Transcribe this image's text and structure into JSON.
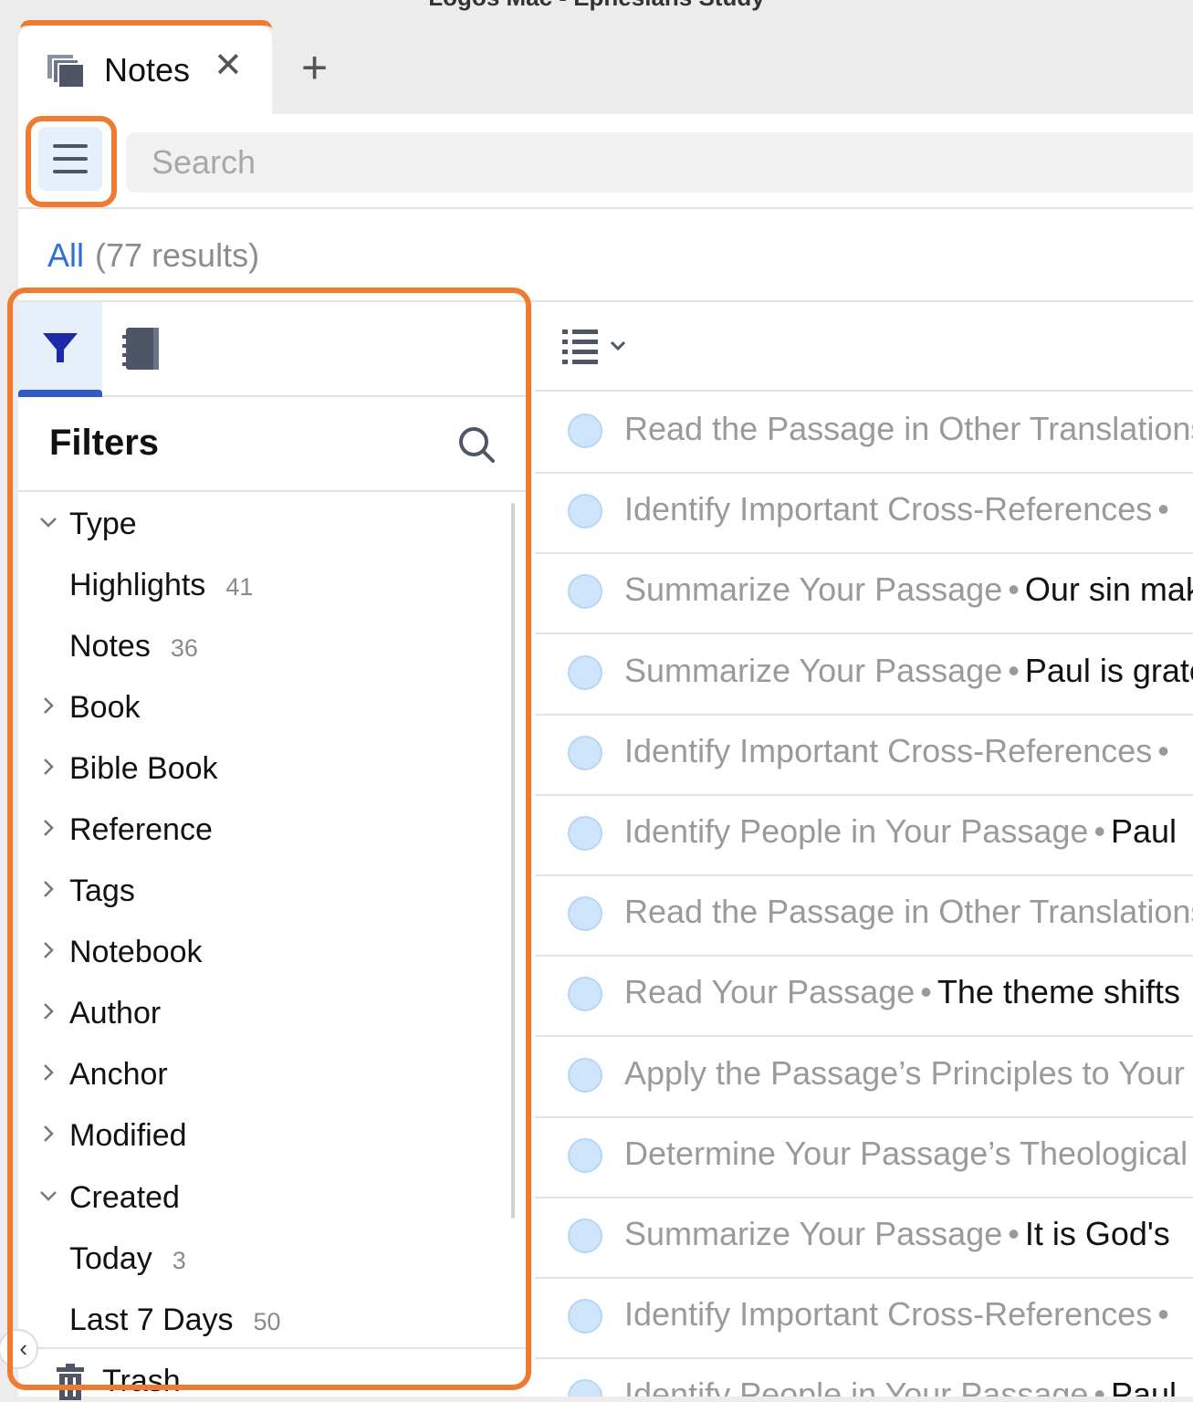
{
  "window": {
    "title": "Logos Mac - Ephesians Study"
  },
  "tabs": [
    {
      "label": "Notes",
      "close": "✕"
    }
  ],
  "add_tab": "+",
  "search": {
    "placeholder": "Search",
    "value": ""
  },
  "results": {
    "scope": "All",
    "count_text": "(77 results)"
  },
  "sidebar": {
    "tab_filters": "filter-icon",
    "tab_notebooks": "notebook-icon",
    "filters_title": "Filters",
    "tree": [
      {
        "label": "Type",
        "expanded": true,
        "level": 0
      },
      {
        "label": "Highlights",
        "count": "41",
        "level": 1
      },
      {
        "label": "Notes",
        "count": "36",
        "level": 1
      },
      {
        "label": "Book",
        "expanded": false,
        "level": 0
      },
      {
        "label": "Bible Book",
        "expanded": false,
        "level": 0
      },
      {
        "label": "Reference",
        "expanded": false,
        "level": 0
      },
      {
        "label": "Tags",
        "expanded": false,
        "level": 0
      },
      {
        "label": "Notebook",
        "expanded": false,
        "level": 0
      },
      {
        "label": "Author",
        "expanded": false,
        "level": 0
      },
      {
        "label": "Anchor",
        "expanded": false,
        "level": 0
      },
      {
        "label": "Modified",
        "expanded": false,
        "level": 0
      },
      {
        "label": "Created",
        "expanded": true,
        "level": 0
      },
      {
        "label": "Today",
        "count": "3",
        "level": 1
      },
      {
        "label": "Last 7 Days",
        "count": "50",
        "level": 1
      }
    ],
    "trash_label": "Trash",
    "collapse": "‹"
  },
  "notes": [
    {
      "title": "Read the Passage in Other Translations",
      "body": ""
    },
    {
      "title": "Identify Important Cross-References",
      "body": ""
    },
    {
      "title": "Summarize Your Passage",
      "body": "Our sin makes"
    },
    {
      "title": "Summarize Your Passage",
      "body": "Paul is grateful"
    },
    {
      "title": "Identify Important Cross-References",
      "body": ""
    },
    {
      "title": "Identify People in Your Passage",
      "body": "Paul"
    },
    {
      "title": "Read the Passage in Other Translations",
      "body": ""
    },
    {
      "title": "Read Your Passage",
      "body": "The theme shifts"
    },
    {
      "title": "Apply the Passage’s Principles to Your Life",
      "body": ""
    },
    {
      "title": "Determine Your Passage’s Theological",
      "body": ""
    },
    {
      "title": "Summarize Your Passage",
      "body": "It is God's"
    },
    {
      "title": "Identify Important Cross-References",
      "body": ""
    },
    {
      "title": "Identify People in Your Passage",
      "body": "Paul"
    }
  ],
  "colors": {
    "accent": "#2c6fd6",
    "highlight_outline": "#ef7b31",
    "note_dot": "#cfe5fb"
  }
}
